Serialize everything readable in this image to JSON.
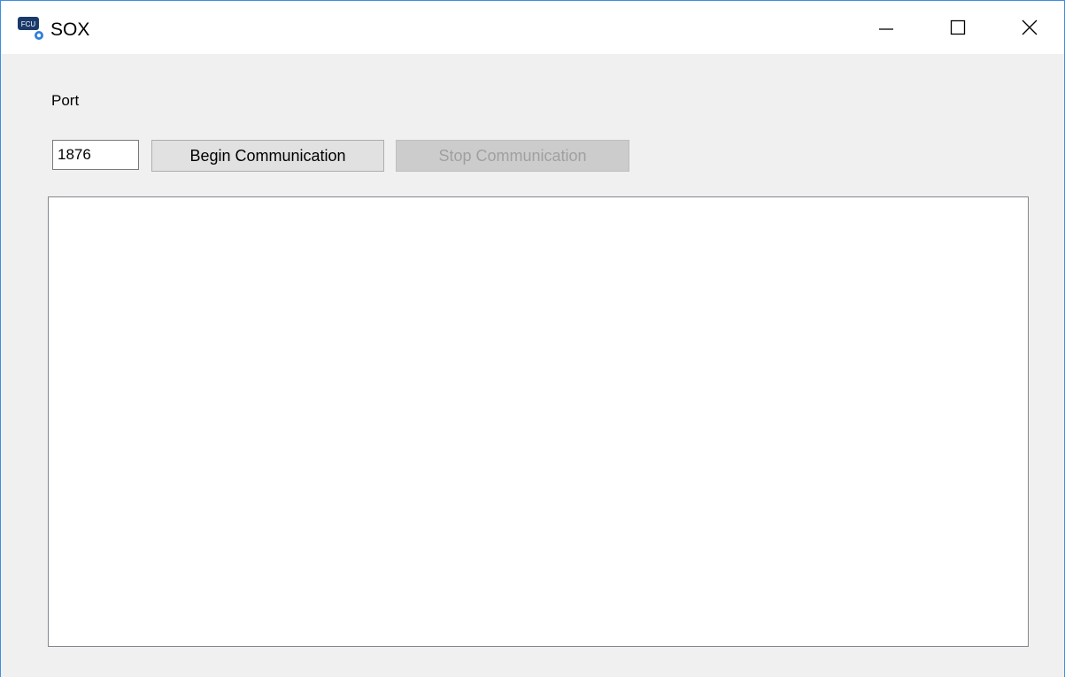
{
  "window": {
    "title": "SOX",
    "icon_text": "FCU",
    "icons": [
      "app-icon",
      "minimize-icon",
      "maximize-icon",
      "close-icon"
    ]
  },
  "form": {
    "port_label": "Port",
    "port_value": "1876",
    "begin_button_label": "Begin Communication",
    "stop_button_label": "Stop Communication",
    "log_text": ""
  },
  "colors": {
    "window_border": "#3d8ee0",
    "client_background": "#f0f0f0",
    "icon_navy": "#1a3a6b",
    "disabled_text": "#a0a0a0"
  }
}
